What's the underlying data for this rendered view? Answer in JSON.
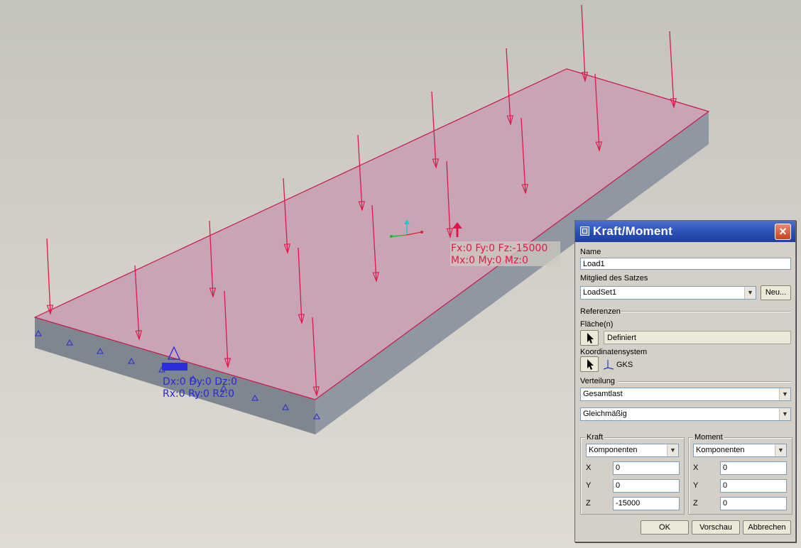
{
  "scene": {
    "load_label_line1": "Fx:0 Fy:0 Fz:-15000",
    "load_label_line2": "Mx:0 My:0 Mz:0",
    "constraint_label_line1": "Dx:0 Dy:0 Dz:0",
    "constraint_label_line2": "Rx:0 Ry:0 Rz:0",
    "colors": {
      "plate_top": "#c8a2b5",
      "plate_side_front": "#7f8792",
      "plate_side_right": "#8e96a2",
      "load_arrow": "#e0174a",
      "constraint": "#2828d6"
    }
  },
  "dialog": {
    "title": "Kraft/Moment",
    "close_icon": "close-icon",
    "name_label": "Name",
    "name_value": "Load1",
    "member_label": "Mitglied des Satzes",
    "member_value": "LoadSet1",
    "new_button": "Neu...",
    "references_label": "Referenzen",
    "surfaces_label": "Fläche(n)",
    "surfaces_value": "Definiert",
    "csys_label": "Koordinatensystem",
    "csys_value": "GKS",
    "distribution_label": "Verteilung",
    "distribution_value": "Gesamtlast",
    "spatial_value": "Gleichmäßig",
    "force": {
      "title": "Kraft",
      "mode": "Komponenten",
      "x_label": "X",
      "x_value": "0",
      "y_label": "Y",
      "y_value": "0",
      "z_label": "Z",
      "z_value": "-15000"
    },
    "moment": {
      "title": "Moment",
      "mode": "Komponenten",
      "x_label": "X",
      "x_value": "0",
      "y_label": "Y",
      "y_value": "0",
      "z_label": "Z",
      "z_value": "0"
    },
    "ok_button": "OK",
    "preview_button": "Vorschau",
    "cancel_button": "Abbrechen"
  }
}
